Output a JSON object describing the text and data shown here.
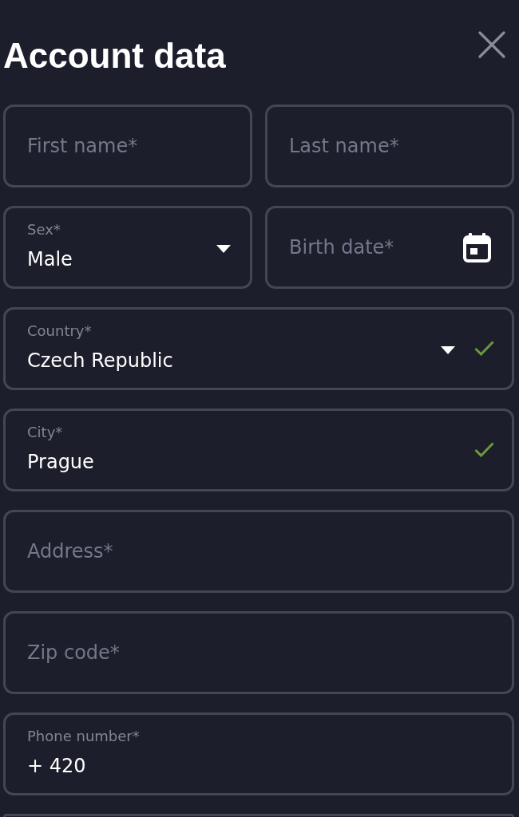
{
  "dialog": {
    "title": "Account data"
  },
  "rows": [
    {
      "fields": [
        {
          "kind": "text",
          "placeholder": "First name*",
          "valid": false
        },
        {
          "kind": "text",
          "placeholder": "Last name*",
          "valid": false
        }
      ]
    },
    {
      "fields": [
        {
          "kind": "select",
          "label": "Sex*",
          "value": "Male",
          "valid": false
        },
        {
          "kind": "date",
          "placeholder": "Birth date*",
          "valid": false
        }
      ]
    },
    {
      "fields": [
        {
          "kind": "select",
          "label": "Country*",
          "value": "Czech Republic",
          "valid": true
        }
      ]
    },
    {
      "fields": [
        {
          "kind": "text",
          "label": "City*",
          "value": "Prague",
          "valid": true
        }
      ]
    },
    {
      "fields": [
        {
          "kind": "text",
          "placeholder": "Address*",
          "valid": false
        }
      ]
    },
    {
      "fields": [
        {
          "kind": "text",
          "placeholder": "Zip code*",
          "valid": false
        }
      ]
    },
    {
      "fields": [
        {
          "kind": "text",
          "label": "Phone number*",
          "value": "+ 420",
          "valid": false
        }
      ]
    },
    {
      "fields": [
        {
          "kind": "partial"
        }
      ]
    }
  ]
}
